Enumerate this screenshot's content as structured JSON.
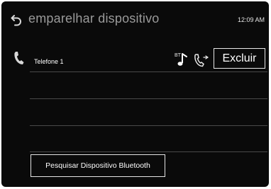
{
  "header": {
    "title": "emparelhar dispositivo",
    "time": "12:09 AM",
    "back_icon": "back-arrow-icon"
  },
  "device_list": {
    "items": [
      {
        "label": "Telefone 1",
        "icon": "phone-icon",
        "status_icons": [
          "bluetooth-audio-icon",
          "bluetooth-phone-icon"
        ],
        "bt_badge": "BT"
      }
    ],
    "delete_label": "Excluir"
  },
  "actions": {
    "search_label": "Pesquisar Dispositivo Bluetooth"
  },
  "colors": {
    "background": "#0a0a0a",
    "title_text": "#9a9a9a",
    "text": "#ffffff",
    "divider": "#4a4a4a"
  }
}
